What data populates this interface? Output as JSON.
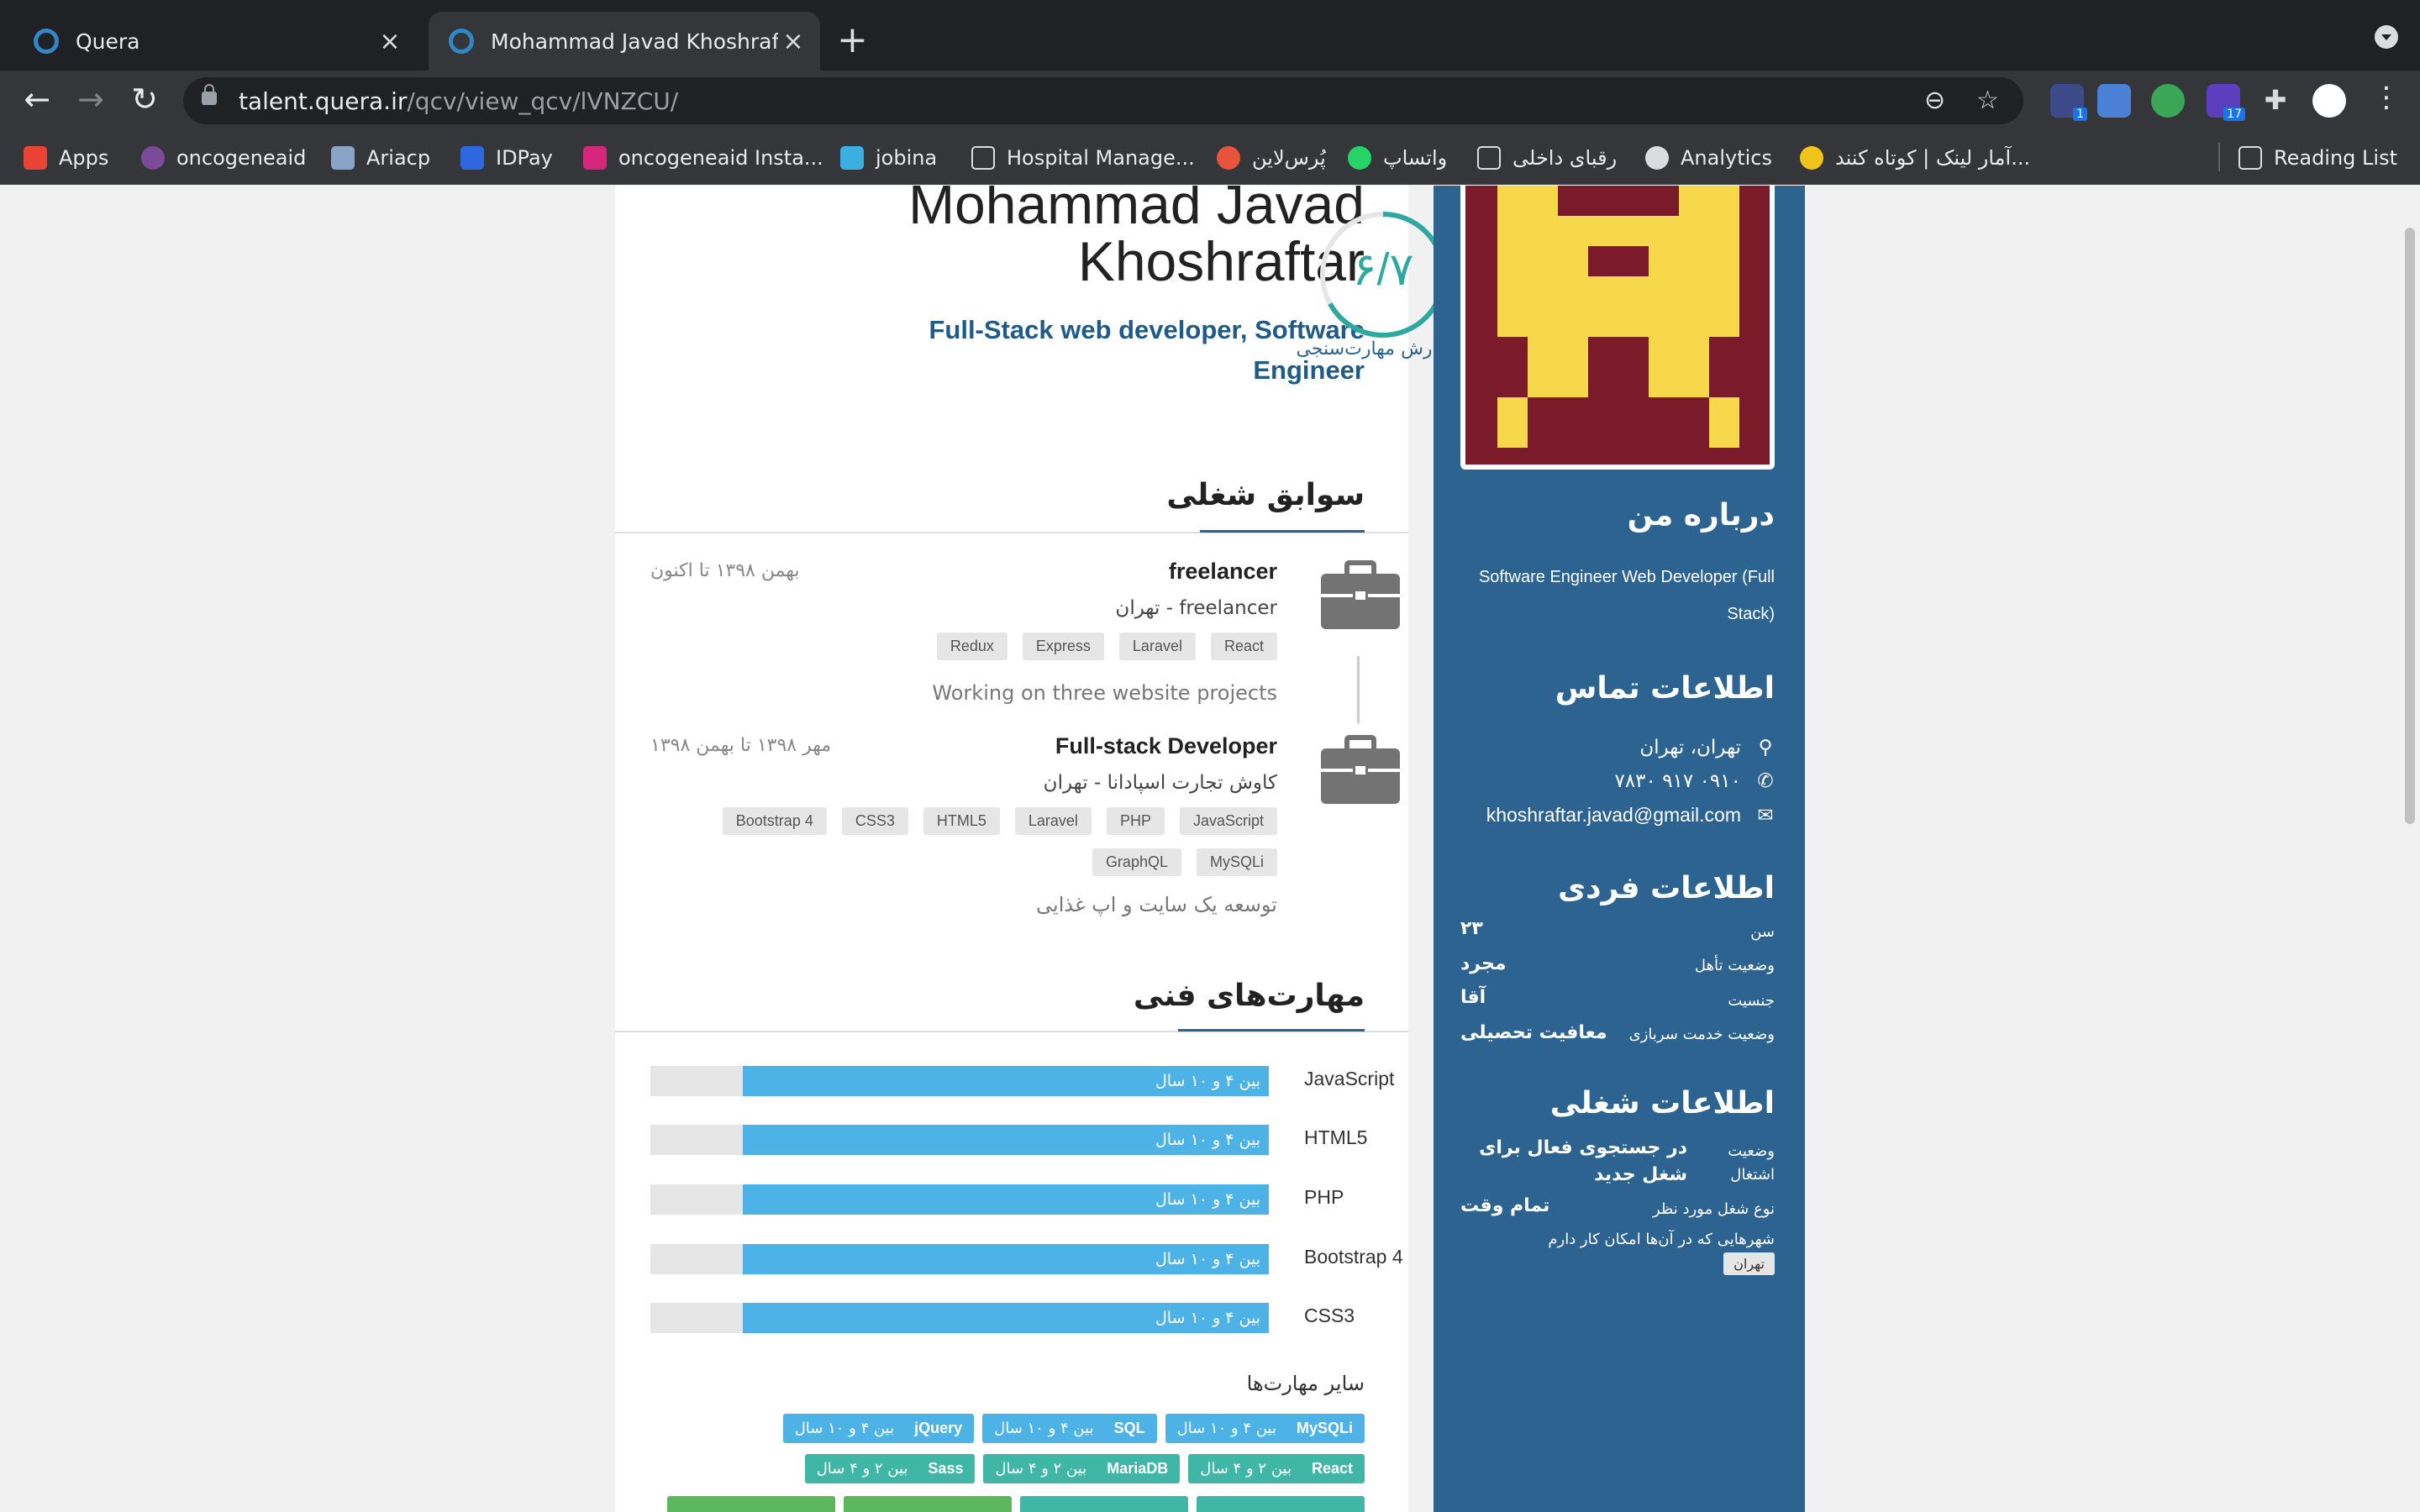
{
  "browser": {
    "tabs": [
      {
        "title": "Quera"
      },
      {
        "title": "Mohammad Javad Khoshraftar"
      }
    ],
    "new_tab": "+",
    "url_host": "talent.quera.ir",
    "url_path": "/qcv/view_qcv/lVNZCU/",
    "ext_badges": [
      "1",
      "17"
    ],
    "bookmarks": [
      "Apps",
      "oncogeneaid",
      "Ariacp",
      "IDPay",
      "oncogeneaid Insta...",
      "jobina",
      "Hospital Manage...",
      "پُرس‌لاین",
      "واتساپ",
      "رقبای داخلی",
      "Analytics",
      "آمار لینک | کوتاه کنند..."
    ],
    "reading_list": "Reading List"
  },
  "profile": {
    "name": "Mohammad Javad Khoshraftar",
    "headline": "Full-Stack web developer, Software Engineer",
    "score": "۶/۷",
    "score_fraction": 0.67,
    "report_link": "گزارش مهارت‌سنجی"
  },
  "experience": {
    "title": "سوابق شغلی",
    "jobs": [
      {
        "title": "freelancer",
        "company": "freelancer - تهران",
        "date": "بهمن ۱۳۹۸ تا اکنون",
        "tags": [
          "React",
          "Laravel",
          "Express",
          "Redux"
        ],
        "description": "Working on three website projects"
      },
      {
        "title": "Full-stack Developer",
        "company": "کاوش تجارت اسپادانا - تهران",
        "date": "مهر ۱۳۹۸ تا بهمن ۱۳۹۸",
        "tags": [
          "JavaScript",
          "PHP",
          "Laravel",
          "HTML5",
          "CSS3",
          "Bootstrap 4",
          "MySQLi",
          "GraphQL"
        ],
        "description": "توسعه یک سایت و اپ غذایی"
      }
    ]
  },
  "skills": {
    "title": "مهارت‌های فنی",
    "items": [
      {
        "name": "JavaScript",
        "label": "بین ۴ و ۱۰ سال",
        "level": 0.85
      },
      {
        "name": "HTML5",
        "label": "بین ۴ و ۱۰ سال",
        "level": 0.85
      },
      {
        "name": "PHP",
        "label": "بین ۴ و ۱۰ سال",
        "level": 0.85
      },
      {
        "name": "Bootstrap 4",
        "label": "بین ۴ و ۱۰ سال",
        "level": 0.85
      },
      {
        "name": "CSS3",
        "label": "بین ۴ و ۱۰ سال",
        "level": 0.85
      }
    ],
    "other_title": "سایر مهارت‌ها",
    "other": [
      {
        "name": "MySQLi",
        "label": "بین ۴ و ۱۰ سال",
        "color": "#4db3e6"
      },
      {
        "name": "SQL",
        "label": "بین ۴ و ۱۰ سال",
        "color": "#4db3e6"
      },
      {
        "name": "jQuery",
        "label": "بین ۴ و ۱۰ سال",
        "color": "#4db3e6"
      },
      {
        "name": "React",
        "label": "بین ۲ و ۴ سال",
        "color": "#3fb6a6"
      },
      {
        "name": "MariaDB",
        "label": "بین ۲ و ۴ سال",
        "color": "#3fb6a6"
      },
      {
        "name": "Sass",
        "label": "بین ۲ و ۴ سال",
        "color": "#3fb6a6"
      }
    ]
  },
  "sidebar": {
    "about_title": "درباره من",
    "about_text": "Software Engineer Web Developer (Full Stack)",
    "contact_title": "اطلاعات تماس",
    "location": "تهران، تهران",
    "phone": "۰۹۱۰ ۹۱۷ ۷۸۳۰",
    "email": "khoshraftar.javad@gmail.com",
    "personal_title": "اطلاعات فردی",
    "personal": [
      {
        "key": "سن",
        "value": "۲۳"
      },
      {
        "key": "وضعیت تأهل",
        "value": "مجرد"
      },
      {
        "key": "جنسیت",
        "value": "آقا"
      },
      {
        "key": "وضعیت خدمت سربازی",
        "value": "معافیت تحصیلی"
      }
    ],
    "job_title": "اطلاعات شغلی",
    "employment_key": "وضعیت اشتغال",
    "employment_value": "در جستجوی فعال برای شغل جدید",
    "jobtype_key": "نوع شغل مورد نظر",
    "jobtype_value": "تمام وقت",
    "cities_key": "شهرهایی که در آن‌ها امکان کار دارم",
    "city": "تهران"
  },
  "colors": {
    "brand": "#2d6390",
    "score": "#2fa9a0",
    "bar": "#4db3e6",
    "avatar_bg": "#7b1a2b",
    "avatar_fg": "#f7d84a"
  }
}
